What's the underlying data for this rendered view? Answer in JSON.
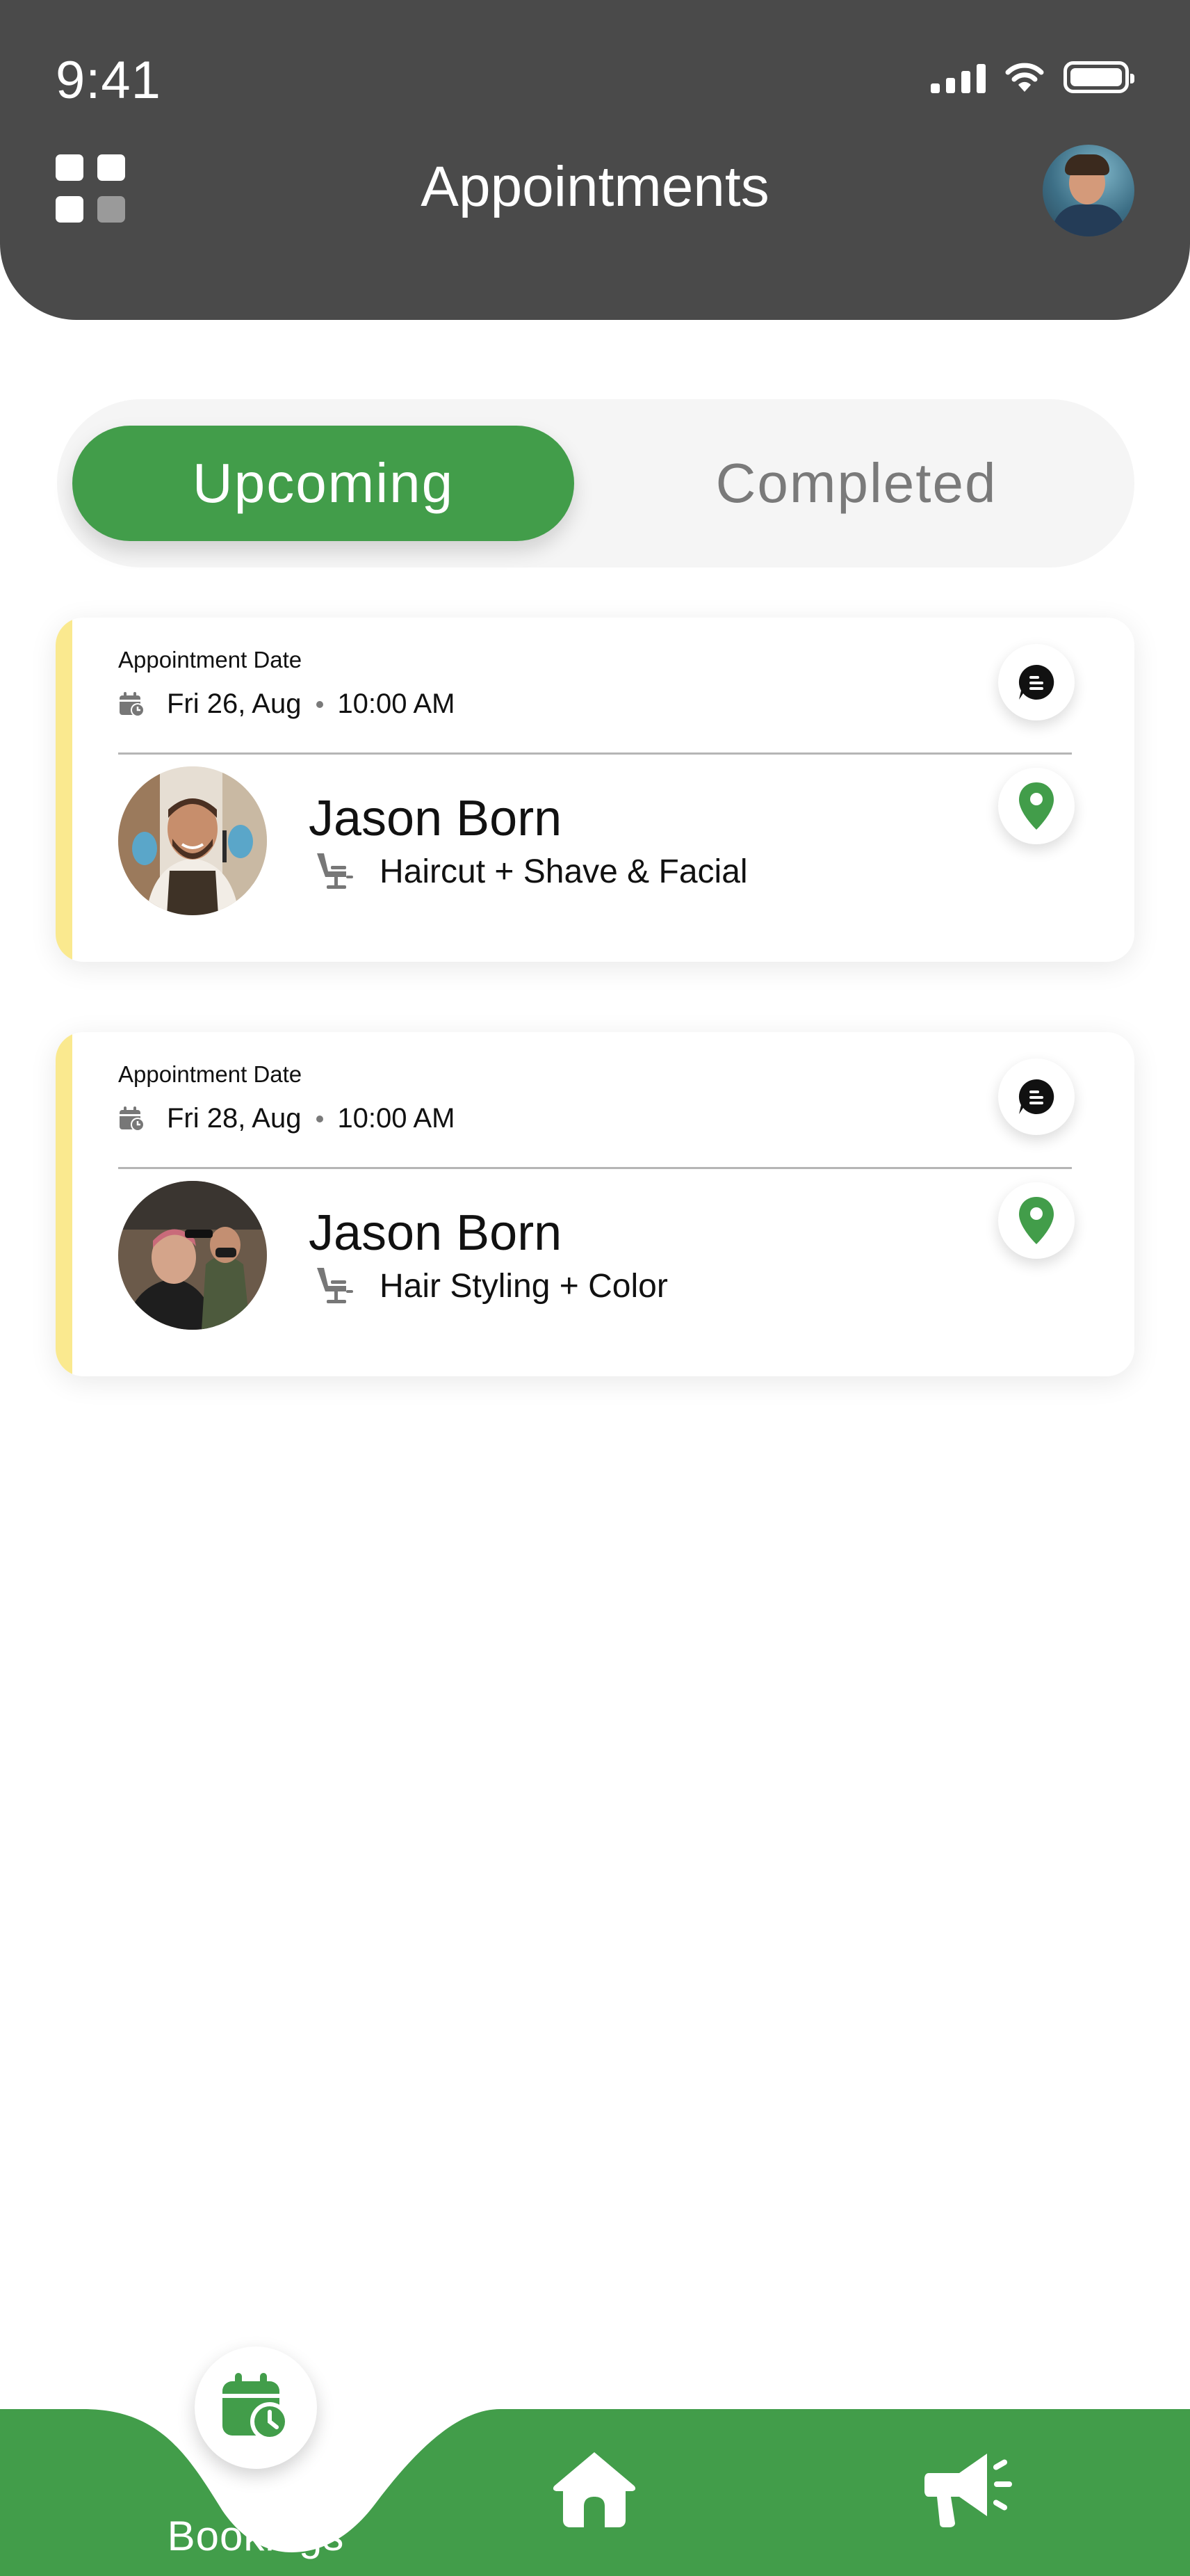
{
  "status_bar": {
    "time": "9:41"
  },
  "header": {
    "title": "Appointments"
  },
  "tabs": [
    {
      "label": "Upcoming",
      "active": true
    },
    {
      "label": "Completed",
      "active": false
    }
  ],
  "appointments": [
    {
      "date_label": "Appointment Date",
      "date": "Fri 26, Aug",
      "time": "10:00 AM",
      "name": "Jason Born",
      "service": "Haircut + Shave & Facial"
    },
    {
      "date_label": "Appointment Date",
      "date": "Fri 28, Aug",
      "time": "10:00 AM",
      "name": "Jason Born",
      "service": "Hair Styling + Color"
    }
  ],
  "bottom_nav": {
    "items": [
      {
        "label": "Bookings",
        "icon": "calendar-clock-icon",
        "active": true
      },
      {
        "label": "",
        "icon": "home-icon",
        "active": false
      },
      {
        "label": "",
        "icon": "megaphone-icon",
        "active": false
      }
    ]
  },
  "colors": {
    "header_bg": "#4a4a4a",
    "accent_green": "#429d4a",
    "card_accent_yellow": "#fae98f",
    "segment_bg": "#f5f5f5"
  }
}
